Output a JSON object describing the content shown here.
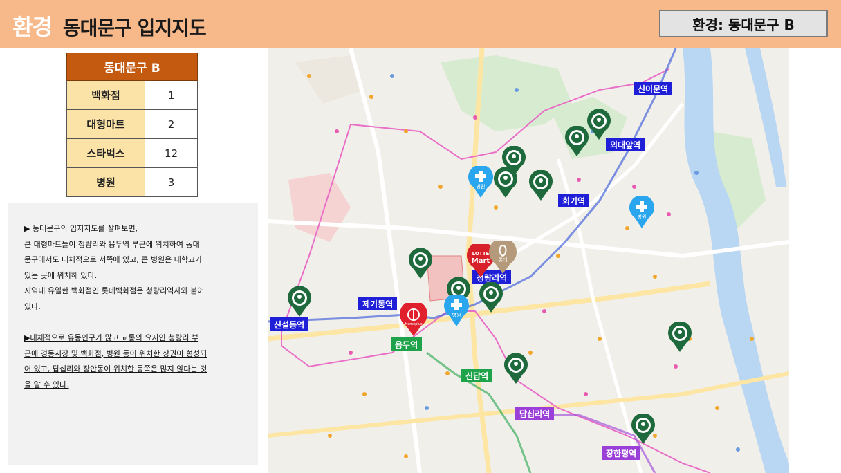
{
  "header": {
    "title_main": "환경",
    "title_sub": "동대문구 입지지도",
    "badge": "환경: 동대문구 B"
  },
  "table": {
    "title": "동대문구 B",
    "rows": [
      {
        "label": "백화점",
        "value": "1"
      },
      {
        "label": "대형마트",
        "value": "2"
      },
      {
        "label": "스타벅스",
        "value": "12"
      },
      {
        "label": "병원",
        "value": "3"
      }
    ]
  },
  "description": {
    "line1": "▶ 동대문구의 입지지도를 살펴보면,",
    "line2": "큰 대형마트들이 청량리와 용두역 부근에 위치하여 동대",
    "line3": "문구에서도 대체적으로 서쪽에 있고, 큰 병원은 대학교가",
    "line4": "있는 곳에 위치해 있다.",
    "line5": "지역내 유일한 백화점인 롯데백화점은 청량리역사와 붙어",
    "line6": "있다.",
    "line7": "▶대체적으로 유동인구가 많고 교통의 요지인 청량리 부",
    "line8": "근에 경동시장 및 백화점, 병원 등이 위치한 상권이 형성되",
    "line9": "어 있고, 답십리와 장안동이 위치한 동쪽은 많지 않다는 것",
    "line10": "을 알 수 있다."
  },
  "map": {
    "stations": {
      "sinimun": "신이문역",
      "oedae": "외대앞역",
      "hoegi": "회기역",
      "cheongnyangni": "청량리역",
      "jegi": "제기동역",
      "sinseol": "신설동역",
      "yongdu": "용두역",
      "sindap": "신답역",
      "dapsimni": "답십리역",
      "janghanpyeong": "장한평역"
    },
    "markers": {
      "hospital_label": "병원",
      "lotte_mart_line1": "LOTTE",
      "lotte_mart_line2": "Mart",
      "lotte_dept_label": "롯데",
      "homeplus_label": "Homeplus"
    },
    "icons": {
      "starbucks": "starbucks-icon",
      "hospital": "hospital-icon",
      "mart": "lotte-mart-icon",
      "department": "lotte-department-store-icon",
      "homeplus": "homeplus-icon"
    },
    "colors": {
      "starbucks": "#1e6a3c",
      "hospital": "#2aa6ee",
      "lotte": "#d8202a",
      "lotte_dept": "#b49a7a",
      "line_blue": "#1f1fd8",
      "line_green": "#1fa34a",
      "line_purple": "#9a40d8"
    }
  }
}
